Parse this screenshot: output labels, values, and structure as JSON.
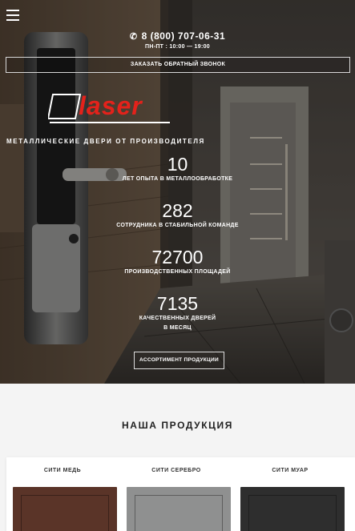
{
  "header": {
    "phone": "8 (800) 707-06-31",
    "hours": "ПН-ПТ : 10:00 — 19:00",
    "callback_label": "ЗАКАЗАТЬ ОБРАТНЫЙ ЗВОНОК"
  },
  "brand": {
    "logo_text": "laser",
    "logo_color": "#e3221b",
    "tagline": "МЕТАЛЛИЧЕСКИЕ ДВЕРИ ОТ ПРОИЗВОДИТЕЛЯ"
  },
  "stats": [
    {
      "value": "10",
      "label": "ЛЕТ ОПЫТА В МЕТАЛЛООБРАБОТКЕ"
    },
    {
      "value": "282",
      "label": "СОТРУДНИКА В СТАБИЛЬНОЙ КОМАНДЕ"
    },
    {
      "value": "72700",
      "label": "ПРОИЗВОДСТВЕННЫХ ПЛОЩАДЕЙ"
    },
    {
      "value": "7135",
      "label": "КАЧЕСТВЕННЫХ ДВЕРЕЙ",
      "label2": "В МЕСЯЦ"
    }
  ],
  "assortment_label": "АССОРТИМЕНТ ПРОДУКЦИИ",
  "products": {
    "title": "НАША ПРОДУКЦИЯ",
    "items": [
      {
        "name": "СИТИ МЕДЬ",
        "color": "#5a3428"
      },
      {
        "name": "СИТИ СЕРЕБРО",
        "color": "#8f9090"
      },
      {
        "name": "СИТИ МУАР",
        "color": "#2e2e2e"
      }
    ]
  },
  "icons": {
    "menu": "hamburger-menu-icon",
    "phone": "phone-icon"
  }
}
